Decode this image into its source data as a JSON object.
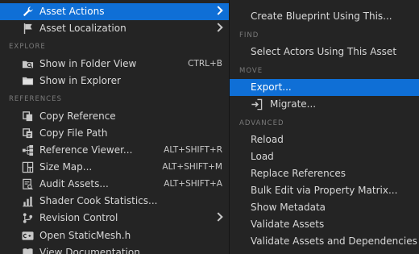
{
  "left_menu": {
    "items": [
      {
        "label": "Asset Actions",
        "submenu": true,
        "selected": true,
        "icon": "wrench-icon"
      },
      {
        "label": "Asset Localization",
        "submenu": true,
        "icon": "flag-icon"
      },
      {
        "section": "EXPLORE"
      },
      {
        "label": "Show in Folder View",
        "shortcut": "CTRL+B",
        "icon": "folder-search-icon"
      },
      {
        "label": "Show in Explorer",
        "icon": "folder-icon"
      },
      {
        "section": "REFERENCES"
      },
      {
        "label": "Copy Reference",
        "icon": "copy-icon"
      },
      {
        "label": "Copy File Path",
        "icon": "file-path-icon"
      },
      {
        "label": "Reference Viewer...",
        "shortcut": "ALT+SHIFT+R",
        "icon": "reference-viewer-icon"
      },
      {
        "label": "Size Map...",
        "shortcut": "ALT+SHIFT+M",
        "icon": "size-map-icon"
      },
      {
        "label": "Audit Assets...",
        "shortcut": "ALT+SHIFT+A",
        "icon": "audit-icon"
      },
      {
        "label": "Shader Cook Statistics...",
        "icon": "statistics-icon"
      },
      {
        "label": "Revision Control",
        "submenu": true,
        "icon": "revision-control-icon"
      },
      {
        "label": "Open StaticMesh.h",
        "icon": "cpp-file-icon"
      },
      {
        "label": "View Documentation",
        "icon": "documentation-icon"
      }
    ]
  },
  "right_menu": {
    "items": [
      {
        "label": "Create Blueprint Using This..."
      },
      {
        "section": "FIND"
      },
      {
        "label": "Select Actors Using This Asset"
      },
      {
        "section": "MOVE"
      },
      {
        "label": "Export...",
        "selected": true
      },
      {
        "label": "Migrate...",
        "icon": "migrate-icon"
      },
      {
        "section": "ADVANCED"
      },
      {
        "label": "Reload"
      },
      {
        "label": "Load"
      },
      {
        "label": "Replace References"
      },
      {
        "label": "Bulk Edit via Property Matrix..."
      },
      {
        "label": "Show Metadata"
      },
      {
        "label": "Validate Assets"
      },
      {
        "label": "Validate Assets and Dependencies"
      }
    ]
  },
  "colors": {
    "menu_bg": "#242424",
    "selected_bg": "#0f6fd6",
    "section_text": "#7a7a7a",
    "text": "#d8d8d8"
  }
}
